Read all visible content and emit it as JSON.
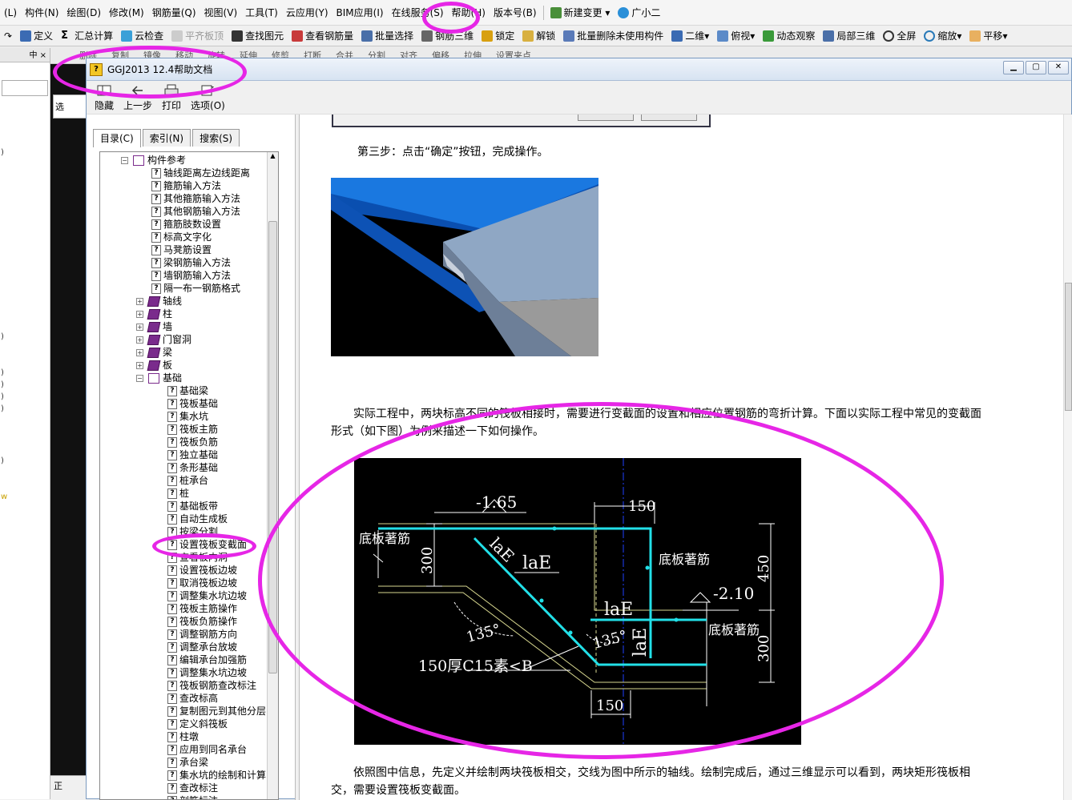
{
  "menubar": {
    "items": [
      "(L)",
      "构件(N)",
      "绘图(D)",
      "修改(M)",
      "钢筋量(Q)",
      "视图(V)",
      "工具(T)",
      "云应用(Y)",
      "BIM应用(I)",
      "在线服务(S)",
      "帮助(H)",
      "版本号(B)",
      "新建变更",
      "广小二"
    ]
  },
  "toolbar": {
    "items": [
      "定义",
      "汇总计算",
      "云检查",
      "平齐板顶",
      "查找图元",
      "查看钢筋量",
      "批量选择",
      "钢筋三维",
      "锁定",
      "解锁",
      "批量删除未使用构件",
      "二维",
      "俯视",
      "动态观察",
      "局部三维",
      "全屏",
      "缩放",
      "平移"
    ]
  },
  "toolbar2": {
    "items": [
      "删除",
      "复制",
      "镜像",
      "移动",
      "旋转",
      "延伸",
      "修剪",
      "打断",
      "合并",
      "分割",
      "对齐",
      "偏移",
      "拉伸",
      "设置夹点"
    ]
  },
  "help_window": {
    "title": "GGJ2013 12.4帮助文档",
    "toolbar": [
      "隐藏",
      "上一步",
      "打印",
      "选项(O)"
    ],
    "tabs": [
      "目录(C)",
      "索引(N)",
      "搜索(S)"
    ],
    "tree": {
      "root": "构件参考",
      "ref_items": [
        "轴线距离左边线距离",
        "箍筋输入方法",
        "其他箍筋输入方法",
        "其他钢筋输入方法",
        "箍筋肢数设置",
        "标高文字化",
        "马凳筋设置",
        "梁钢筋输入方法",
        "墙钢筋输入方法",
        "隔一布一钢筋格式"
      ],
      "books": [
        "轴线",
        "柱",
        "墙",
        "门窗洞",
        "梁",
        "板"
      ],
      "open_book": "基础",
      "foundation_items": [
        "基础梁",
        "筏板基础",
        "集水坑",
        "筏板主筋",
        "筏板负筋",
        "独立基础",
        "条形基础",
        "桩承台",
        "桩",
        "基础板带",
        "自动生成板",
        "按梁分割",
        "设置筏板变截面",
        "查看板内洞",
        "设置筏板边坡",
        "取消筏板边坡",
        "调整集水坑边坡",
        "筏板主筋操作",
        "筏板负筋操作",
        "调整钢筋方向",
        "调整承台放坡",
        "编辑承台加强筋",
        "调整集水坑边坡",
        "筏板钢筋查改标注",
        "查改标高",
        "复制图元到其他分层",
        "定义斜筏板",
        "柱墩",
        "应用到同名承台",
        "承台梁",
        "集水坑的绘制和计算",
        "查改标注",
        "剖筋标注"
      ]
    },
    "content": {
      "step3": "第三步：点击“确定”按钮，完成操作。",
      "para1_line1": "实际工程中，两块标高不同的筏板相接时，需要进行变截面的设置和相应位置钢筋的弯折计算。下面以实际工程中常见的变截面",
      "para1_line2": "形式（如下图）为例来描述一下如何操作。",
      "para2_line1": "依照图中信息，先定义并绘制两块筏板相交，交线为图中所示的轴线。绘制完成后，通过三维显示可以看到，两块矩形筏板相",
      "para2_line2": "交，需要设置筏板变截面。"
    },
    "cad": {
      "elev_left": "-1.65",
      "elev_right": "-2.10",
      "dim_150_top": "150",
      "dim_150_bottom": "150",
      "dim_300_left": "300",
      "dim_300_right": "300",
      "dim_450": "450",
      "label_bottom_rebar_left": "底板著筋",
      "label_bottom_rebar_mid": "底板著筋",
      "label_bottom_rebar_right": "底板著筋",
      "lae_diag": "laE",
      "lae_top": "laE",
      "lae_mid": "laE",
      "lae_vert": "laE",
      "angle_left": "135°",
      "angle_right": "135°",
      "cushion": "150厚C15素<B"
    }
  },
  "left_strip": {
    "header": "中",
    "bottom": "正"
  },
  "left_panel2": {
    "label": "选"
  },
  "colors": {
    "annotation": "#e626e6",
    "cad_rebar": "#22e0e8",
    "cad_axis": "#2040ff",
    "cad_line": "#d8d890"
  }
}
